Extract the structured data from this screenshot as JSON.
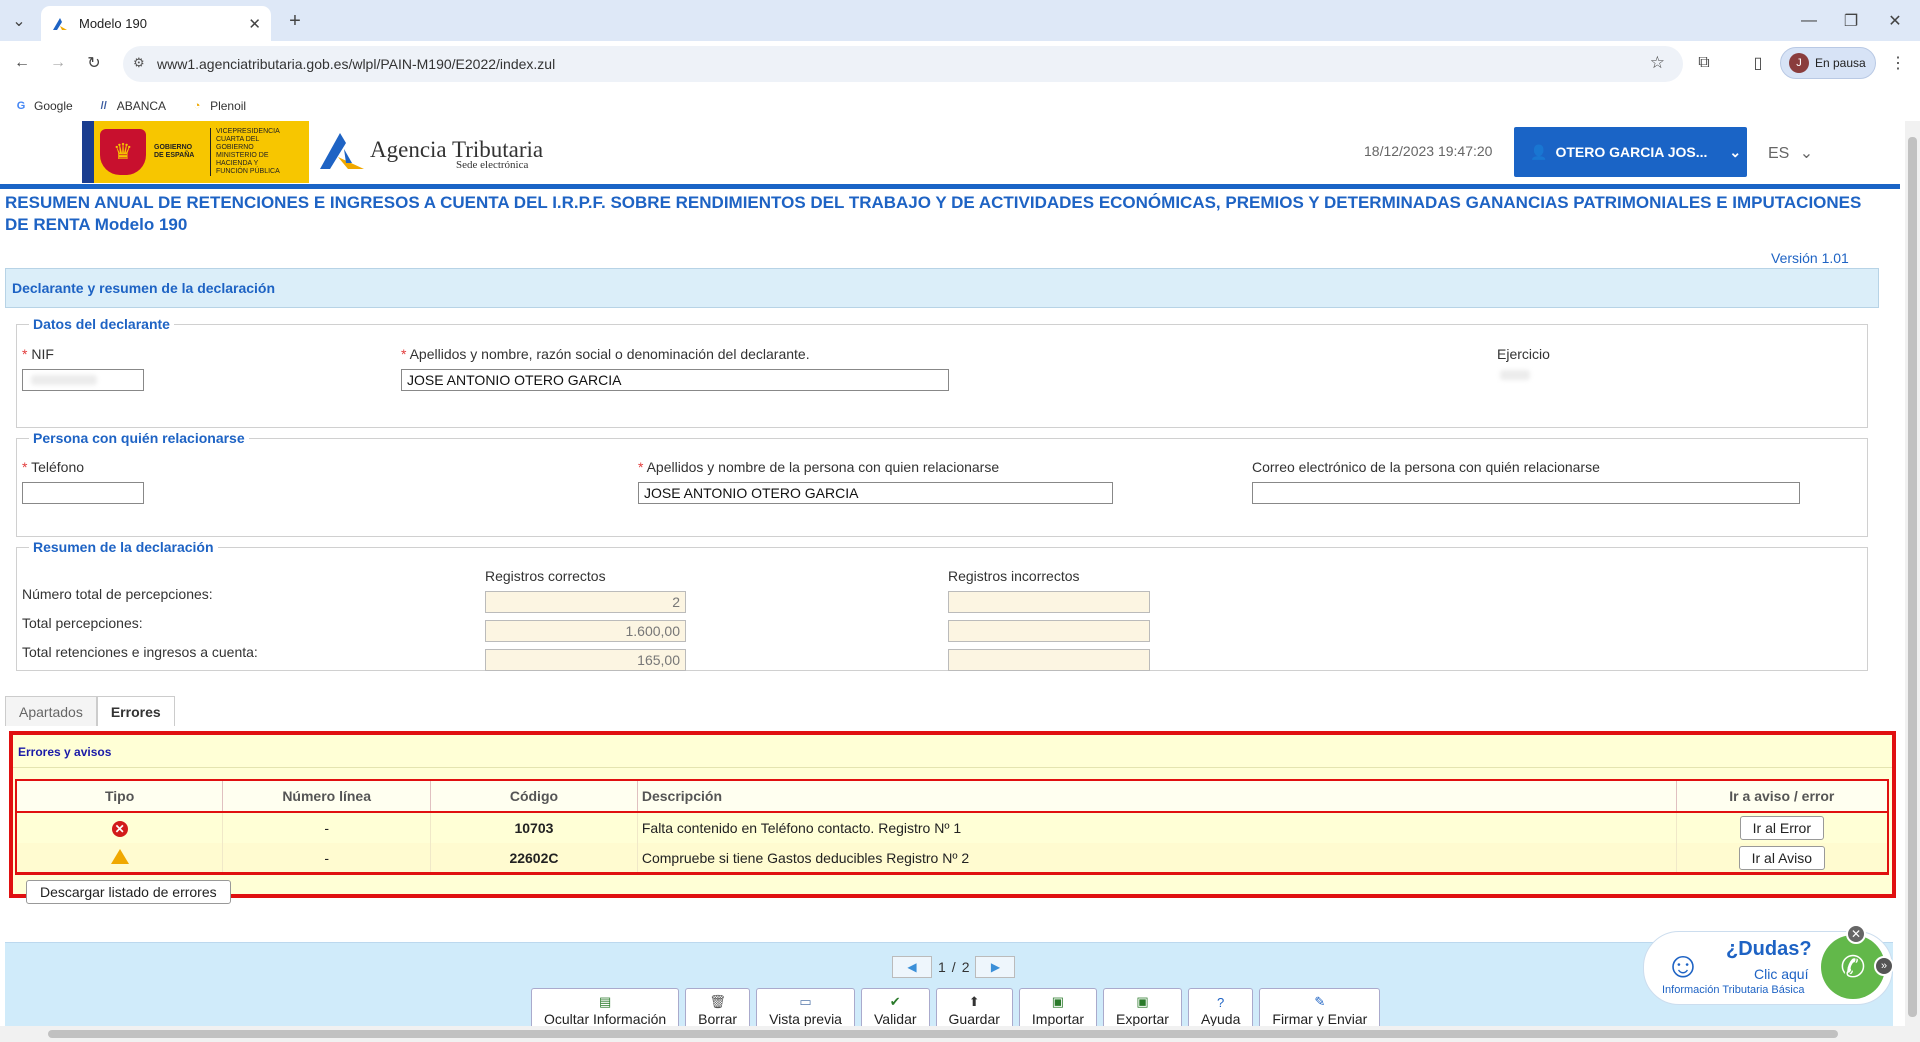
{
  "browser": {
    "tab_title": "Modelo 190",
    "url": "www1.agenciatributaria.gob.es/wlpl/PAIN-M190/E2022/index.zul",
    "profile_label": "En pausa",
    "profile_initial": "J",
    "bookmarks": [
      {
        "label": "Google",
        "icon": "google-icon"
      },
      {
        "label": "ABANCA",
        "icon": "abanca-icon"
      },
      {
        "label": "Plenoil",
        "icon": "plenoil-icon"
      }
    ]
  },
  "header": {
    "gov_text_1": "GOBIERNO DE ESPAÑA",
    "gov_text_2": "VICEPRESIDENCIA CUARTA DEL GOBIERNO MINISTERIO DE HACIENDA Y FUNCIÓN PÚBLICA",
    "agency_title": "Agencia Tributaria",
    "agency_subtitle": "Sede electrónica",
    "datetime": "18/12/2023 19:47:20",
    "user_name": "OTERO GARCIA JOS...",
    "language": "ES"
  },
  "page": {
    "title": "RESUMEN ANUAL DE RETENCIONES E INGRESOS A CUENTA DEL I.R.P.F. SOBRE RENDIMIENTOS DEL TRABAJO Y DE ACTIVIDADES ECONÓMICAS, PREMIOS Y DETERMINADAS GANANCIAS PATRIMONIALES E IMPUTACIONES DE RENTA Modelo 190",
    "version": "Versión 1.01",
    "section_title": "Declarante y resumen de la declaración"
  },
  "declarante": {
    "legend": "Datos del declarante",
    "nif_label": "NIF",
    "nombre_label": "Apellidos y nombre, razón social o denominación del declarante.",
    "nombre_value": "JOSE ANTONIO OTERO GARCIA",
    "ejercicio_label": "Ejercicio"
  },
  "persona": {
    "legend": "Persona con quién relacionarse",
    "telefono_label": "Teléfono",
    "telefono_value": "",
    "nombre_label": "Apellidos y nombre de la persona con quien relacionarse",
    "nombre_value": "JOSE ANTONIO OTERO GARCIA",
    "correo_label": "Correo electrónico de la persona con quién relacionarse",
    "correo_value": ""
  },
  "resumen": {
    "legend": "Resumen de la declaración",
    "col_correctos": "Registros correctos",
    "col_incorrectos": "Registros incorrectos",
    "rows": [
      {
        "label": "Número total de percepciones:",
        "correctos": "2",
        "incorrectos": ""
      },
      {
        "label": "Total percepciones:",
        "correctos": "1.600,00",
        "incorrectos": ""
      },
      {
        "label": "Total retenciones e ingresos a cuenta:",
        "correctos": "165,00",
        "incorrectos": ""
      }
    ]
  },
  "tabs": [
    {
      "label": "Apartados",
      "active": false
    },
    {
      "label": "Errores",
      "active": true
    }
  ],
  "errores": {
    "title": "Errores y avisos",
    "columns": [
      "Tipo",
      "Número línea",
      "Código",
      "Descripción",
      "Ir a aviso / error"
    ],
    "rows": [
      {
        "tipo": "error-icon",
        "linea": "-",
        "codigo": "10703",
        "descripcion": "Falta contenido en Teléfono contacto. Registro Nº 1",
        "accion": "Ir al Error"
      },
      {
        "tipo": "warning-icon",
        "linea": "-",
        "codigo": "22602C",
        "descripcion": "Compruebe si tiene Gastos deducibles Registro Nº 2",
        "accion": "Ir al Aviso"
      }
    ],
    "download_label": "Descargar listado de errores",
    "error_color": "#e01010"
  },
  "pager": {
    "current": "1",
    "separator": "/",
    "total": "2"
  },
  "actions": [
    {
      "label": "Ocultar Información",
      "icon": "hide-info-icon"
    },
    {
      "label": "Borrar",
      "icon": "trash-icon"
    },
    {
      "label": "Vista previa",
      "icon": "preview-icon"
    },
    {
      "label": "Validar",
      "icon": "check-icon"
    },
    {
      "label": "Guardar",
      "icon": "save-icon"
    },
    {
      "label": "Importar",
      "icon": "import-icon"
    },
    {
      "label": "Exportar",
      "icon": "export-icon"
    },
    {
      "label": "Ayuda",
      "icon": "help-icon"
    },
    {
      "label": "Firmar y Enviar",
      "icon": "sign-send-icon"
    }
  ],
  "dudas": {
    "question": "¿Dudas?",
    "click": "Clic aquí",
    "info": "Información Tributaria Básica"
  },
  "colors": {
    "brand_blue": "#1a64c6",
    "title_blue": "#1e63c4"
  }
}
